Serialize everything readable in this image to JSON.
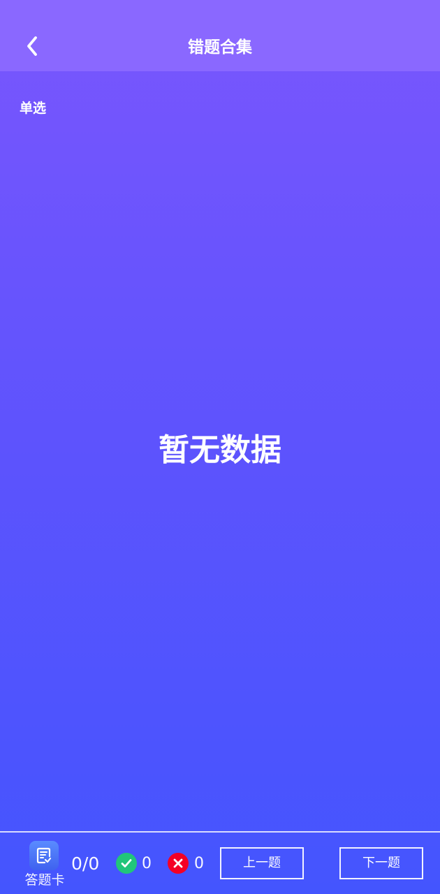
{
  "header": {
    "title": "错题合集",
    "back_icon": "chevron-left-icon"
  },
  "section": {
    "question_type": "单选"
  },
  "content": {
    "empty_message": "暂无数据"
  },
  "bottom_bar": {
    "answer_card_label": "答题卡",
    "progress": "0/0",
    "correct_count": "0",
    "wrong_count": "0",
    "previous_label": "上一题",
    "next_label": "下一题",
    "icons": {
      "answer_card": "answer-card-icon",
      "correct": "check-icon",
      "wrong": "close-icon"
    },
    "colors": {
      "correct": "#21c57a",
      "wrong": "#f40025",
      "answer_card": "#4a78fb"
    }
  },
  "theme": {
    "header_bg": "#8a68ff",
    "gradient_top": "#7a56fd",
    "gradient_bottom": "#4455fe"
  }
}
